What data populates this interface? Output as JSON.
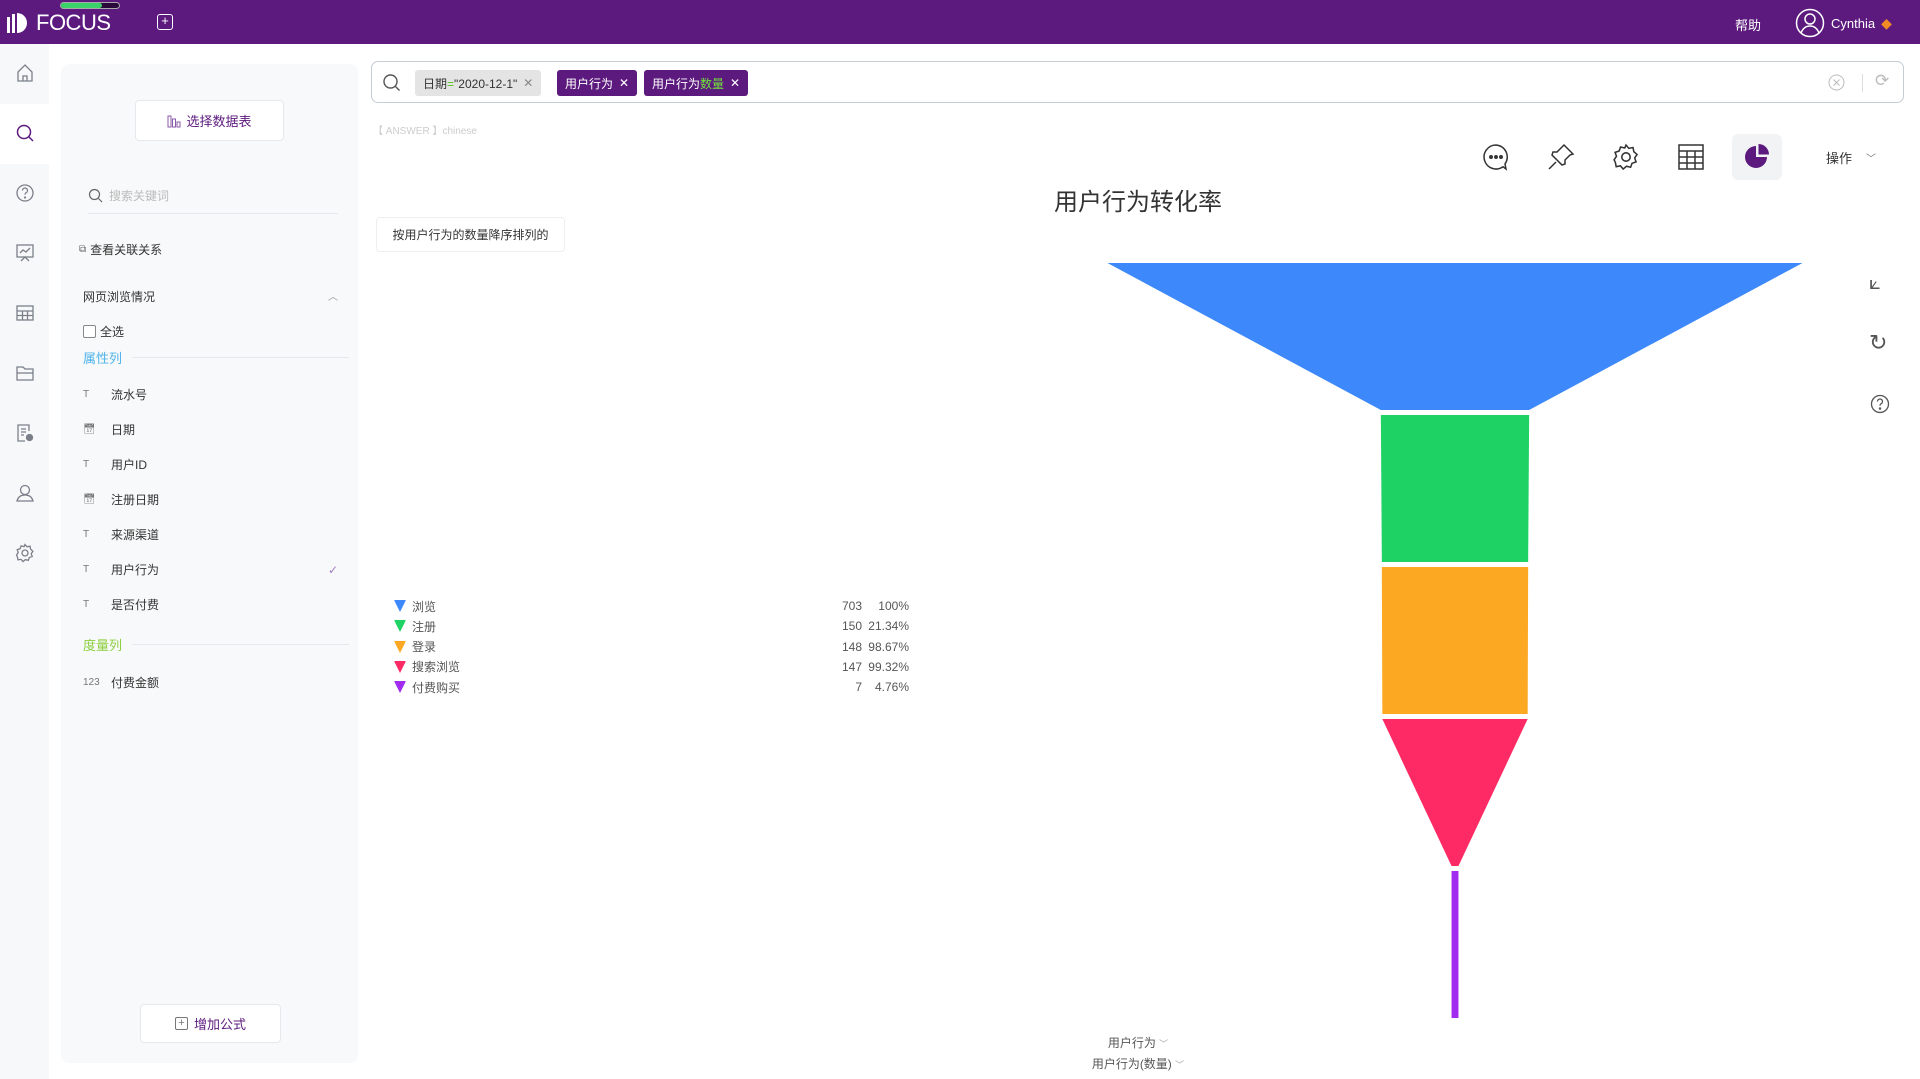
{
  "app": {
    "logo": "FOCUS",
    "help": "帮助",
    "user": "Cynthia"
  },
  "colors": {
    "brand": "#5c1a7e",
    "accent_green": "#52c41a"
  },
  "rail": {
    "icons": [
      "home-icon",
      "search-icon",
      "question-icon",
      "presentation-icon",
      "table-icon",
      "folder-icon",
      "report-settings-icon",
      "user-icon",
      "gear-icon"
    ],
    "active": 1
  },
  "panel": {
    "select_table": "选择数据表",
    "search_placeholder": "搜索关键词",
    "relations": "查看关联关系",
    "group": "网页浏览情况",
    "select_all": "全选",
    "attr_title": "属性列",
    "attributes": [
      {
        "icon": "text",
        "label": "流水号"
      },
      {
        "icon": "date",
        "label": "日期"
      },
      {
        "icon": "text",
        "label": "用户ID"
      },
      {
        "icon": "date",
        "label": "注册日期"
      },
      {
        "icon": "text",
        "label": "来源渠道"
      },
      {
        "icon": "text",
        "label": "用户行为",
        "checked": true
      },
      {
        "icon": "text",
        "label": "是否付费"
      }
    ],
    "measure_title": "度量列",
    "measures": [
      {
        "icon": "123",
        "label": "付费金额"
      }
    ],
    "add_formula": "增加公式"
  },
  "search": {
    "chips": [
      {
        "prefix": "日期",
        "op": "=",
        "value": "\"2020-12-1\""
      },
      {
        "label": "用户行为"
      },
      {
        "prefix": "用户行为",
        "highlight": "数量"
      }
    ]
  },
  "answer_label": "【 ANSWER 】chinese",
  "toolbar": {
    "icons": [
      "comment-icon",
      "pin-icon",
      "gear-icon",
      "table-icon",
      "pie-chart-icon"
    ],
    "action": "操作"
  },
  "sort_note": "按用户行为的数量降序排列的",
  "axis": {
    "x": "用户行为",
    "y": "用户行为(数量)"
  },
  "chart_data": {
    "type": "funnel",
    "title": "用户行为转化率",
    "categories": [
      "浏览",
      "注册",
      "登录",
      "搜索浏览",
      "付费购买"
    ],
    "values": [
      703,
      150,
      148,
      147,
      7
    ],
    "percent_labels": [
      "100%",
      "21.34%",
      "98.67%",
      "99.32%",
      "4.76%"
    ],
    "colors": [
      "#3d88fb",
      "#1fd264",
      "#fda823",
      "#fd2a65",
      "#a12cf0"
    ],
    "legend": "left"
  }
}
